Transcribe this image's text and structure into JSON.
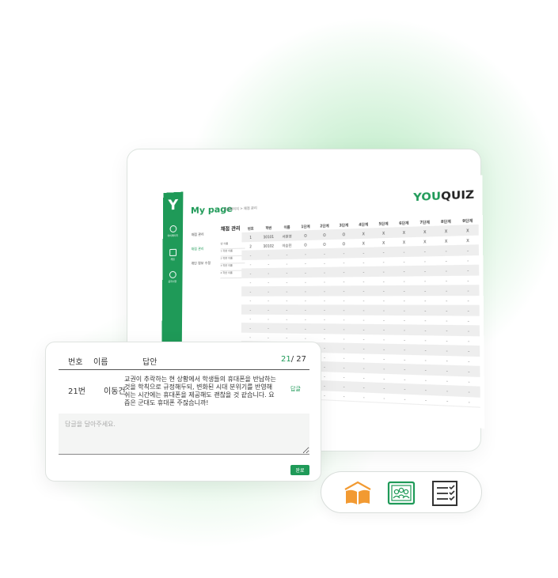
{
  "colors": {
    "accent": "#1f9a58",
    "book": "#f29a32",
    "dark": "#333333"
  },
  "mini_app": {
    "logo": "Y",
    "title": "My page",
    "breadcrumb": "마이페이지 > 채점 관리",
    "brand_you": "YOU",
    "brand_quiz": "QUIZ",
    "nav": [
      "마이페이지",
      "게임",
      "공지사항"
    ],
    "menu": [
      "채점 관리",
      "채점 관리",
      "개인 정보 수정"
    ],
    "sub_heading": "채점 관리",
    "sub_rows": [
      "번 이름",
      "1 학번 이름",
      "2 학번 이름",
      "3 학번 이름",
      "4 학번 이름"
    ],
    "table": {
      "columns": [
        "번호",
        "학번",
        "이름",
        "1단계",
        "2단계",
        "3단계",
        "4단계",
        "5단계",
        "6단계",
        "7단계",
        "8단계",
        "9단계"
      ],
      "rows": [
        [
          "1",
          "10101",
          "서원영",
          "O",
          "O",
          "O",
          "X",
          "X",
          "X",
          "X",
          "X",
          "X"
        ],
        [
          "2",
          "10102",
          "이승민",
          "O",
          "O",
          "O",
          "X",
          "X",
          "X",
          "X",
          "X",
          "X"
        ]
      ],
      "empty_rows": 16,
      "empty_cell": "-"
    }
  },
  "answer_panel": {
    "headers": {
      "number": "번호",
      "name": "이름",
      "answer": "답안"
    },
    "counter_current": "21",
    "counter_total": "/ 27",
    "row": {
      "number": "21번",
      "name": "이동건",
      "answer": "교권이 추락하는 현 상황에서 학생들의 휴대폰을 반납하는 것을 학칙으로 규정해두되, 변화된 시대 분위기를 반영해 쉬는 시간에는 휴대폰을 제공해도 괜찮을 것 같습니다. 요즘은 군대도 휴대폰 주잖습니까!",
      "reply_label": "답글"
    },
    "input_placeholder": "답글을 달아주세요.",
    "done_label": "완료"
  },
  "icon_bar": {
    "icons": [
      "open-book-icon",
      "classroom-board-icon",
      "checklist-icon"
    ]
  }
}
